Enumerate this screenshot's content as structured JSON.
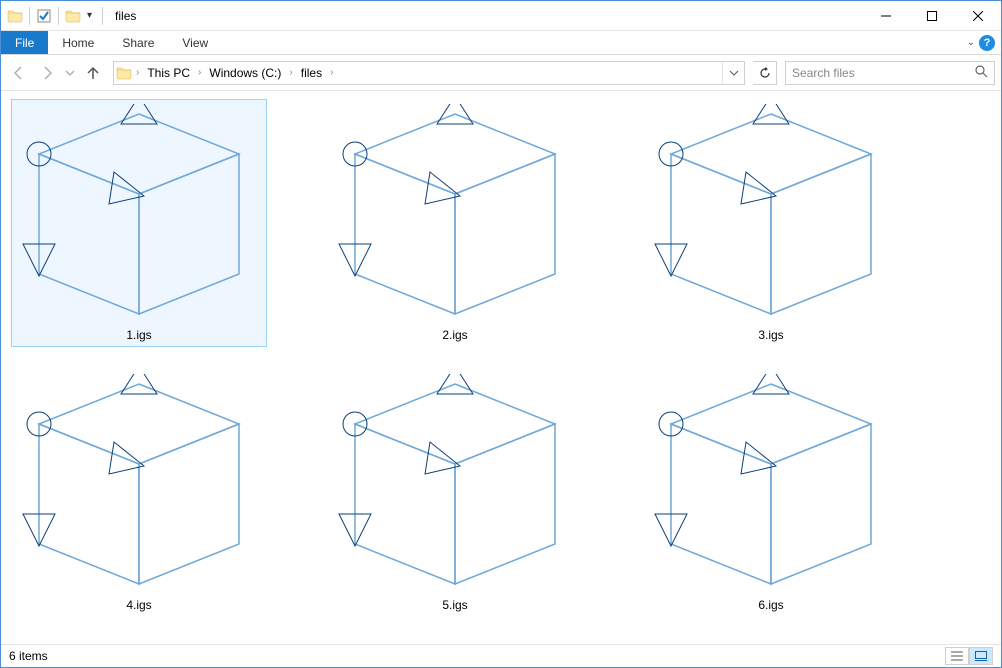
{
  "window": {
    "title": "files"
  },
  "ribbon": {
    "file": "File",
    "home": "Home",
    "share": "Share",
    "view": "View"
  },
  "breadcrumbs": {
    "root": "This PC",
    "drive": "Windows (C:)",
    "folder": "files"
  },
  "search": {
    "placeholder": "Search files"
  },
  "files": [
    {
      "name": "1.igs",
      "selected": true
    },
    {
      "name": "2.igs",
      "selected": false
    },
    {
      "name": "3.igs",
      "selected": false
    },
    {
      "name": "4.igs",
      "selected": false
    },
    {
      "name": "5.igs",
      "selected": false
    },
    {
      "name": "6.igs",
      "selected": false
    }
  ],
  "status": {
    "count_label": "6 items"
  }
}
